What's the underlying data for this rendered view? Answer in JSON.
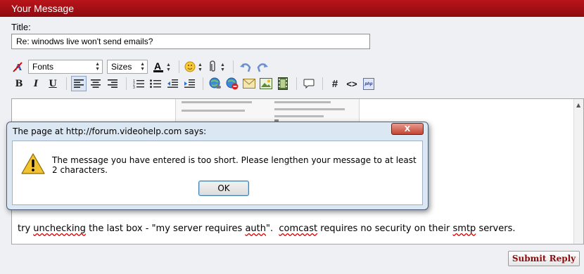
{
  "panel": {
    "title": "Your Message"
  },
  "title_field": {
    "label": "Title:",
    "value": "Re: winodws live won't send emails?"
  },
  "toolbar": {
    "font_select": "Fonts",
    "size_select": "Sizes",
    "bold": "B",
    "italic": "I",
    "underline": "U",
    "hash": "#",
    "code": "<>",
    "php": "php"
  },
  "editor": {
    "segments": [
      {
        "text": "try ",
        "spell": false
      },
      {
        "text": "unchecking",
        "spell": true
      },
      {
        "text": " the last box - \"my server requires ",
        "spell": false
      },
      {
        "text": "auth",
        "spell": true
      },
      {
        "text": "\".  ",
        "spell": false
      },
      {
        "text": "comcast",
        "spell": true
      },
      {
        "text": " requires no security on their ",
        "spell": false
      },
      {
        "text": "smtp",
        "spell": true
      },
      {
        "text": " servers.",
        "spell": false
      }
    ]
  },
  "submit": {
    "label": "Submit Reply"
  },
  "dialog": {
    "title": "The page at http://forum.videohelp.com says:",
    "close": "X",
    "message": "The message you have entered is too short. Please lengthen your message to at least 2 characters.",
    "ok": "OK"
  }
}
